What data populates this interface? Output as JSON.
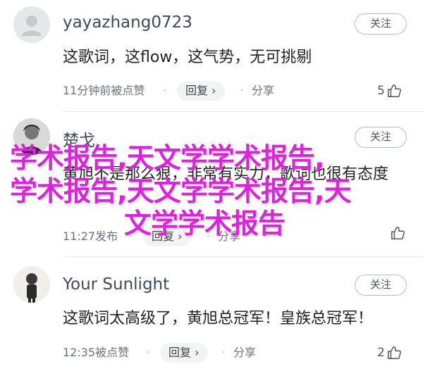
{
  "comments": [
    {
      "username": "yayazhang0723",
      "follow_label": "关注",
      "text": "这歌词，这flow，这气势，无可挑剔",
      "timestamp": "11分钟前被点赞",
      "reply_label": "回复",
      "share_label": "分享",
      "like_count": "5"
    },
    {
      "username": "楚戈",
      "follow_label": "关注",
      "text": "黄旭不是那么狠，非常有实力，歌词也很有态度",
      "timestamp": "11:27发布",
      "reply_label": "回复",
      "share_label": "分享",
      "like_count": ""
    },
    {
      "username": "Your Sunlight",
      "follow_label": "关注",
      "text": "这歌词太高级了，黄旭总冠军！皇族总冠军！",
      "timestamp": "12:35被点赞",
      "reply_label": "回复",
      "share_label": "分享",
      "like_count": "2"
    }
  ],
  "overlay": {
    "line1": "学术报告,天文学学术报告,",
    "line2": "学术报告,天文学学术报告,天",
    "line3": "文学学术报告",
    "color": "#e020e0"
  },
  "icons": {
    "default_avatar": "person-silhouette-icon",
    "like": "thumbs-up-icon",
    "reply_arrow": "chevron-right-icon"
  }
}
